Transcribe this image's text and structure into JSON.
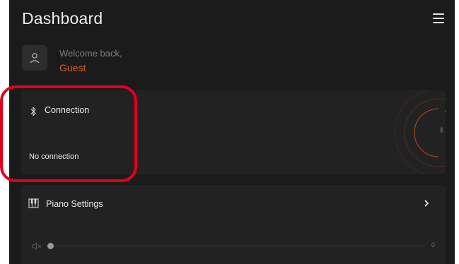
{
  "header": {
    "title": "Dashboard",
    "menu_icon": "hamburger-menu-icon"
  },
  "welcome": {
    "greeting": "Welcome back,",
    "user_name": "Guest",
    "avatar_icon": "user-icon",
    "user_name_color": "#e35a2a"
  },
  "connection": {
    "label": "Connection",
    "icon": "bluetooth-icon",
    "status": "No connection",
    "accent_color": "#e35a2a"
  },
  "piano_settings": {
    "label": "Piano Settings",
    "icon": "piano-keys-icon",
    "chevron_icon": "chevron-right-icon",
    "volume": {
      "icon": "volume-mute-icon",
      "value": "0",
      "level": 0
    }
  },
  "highlight_color": "#e3001b"
}
